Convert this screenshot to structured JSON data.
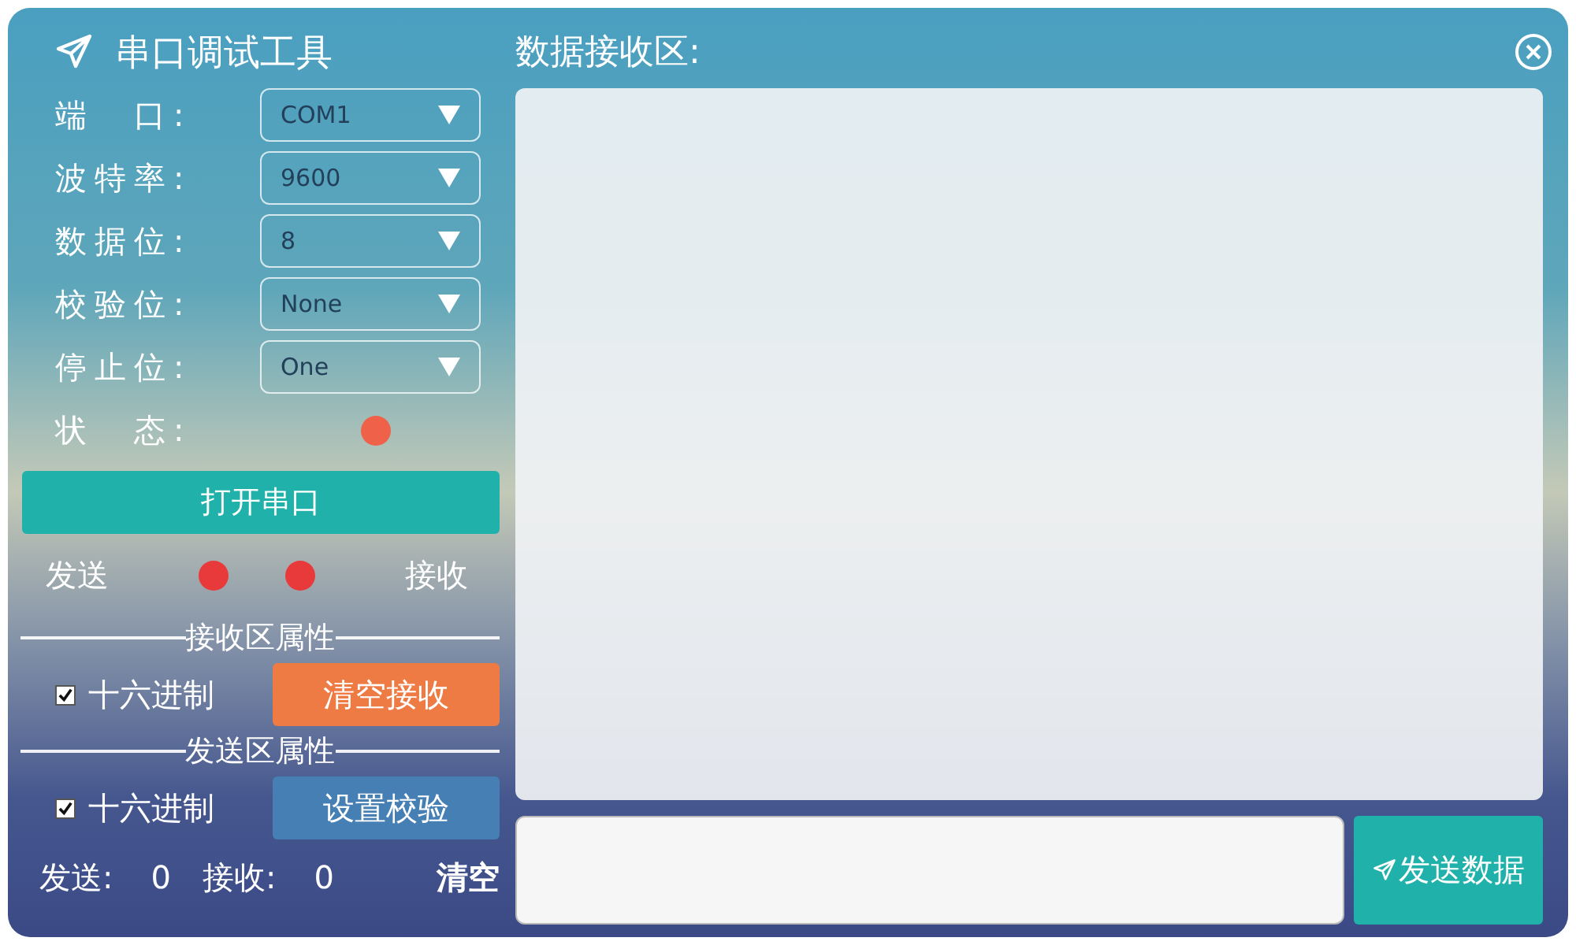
{
  "title": "串口调试工具",
  "settings": [
    {
      "label": "端　口:",
      "value": "COM1"
    },
    {
      "label": "波特率:",
      "value": "9600"
    },
    {
      "label": "数据位:",
      "value": "8"
    },
    {
      "label": "校验位:",
      "value": "None"
    },
    {
      "label": "停止位:",
      "value": "One"
    }
  ],
  "status": {
    "label": "状　态:",
    "color": "#f0614a"
  },
  "open_button": "打开串口",
  "indicators": [
    {
      "label": "发送",
      "color": "#e83a3a"
    },
    {
      "label": "接收",
      "color": "#e83a3a"
    }
  ],
  "receive_section": {
    "title": "接收区属性",
    "hex": {
      "label": "十六进制",
      "checked": true
    },
    "button": {
      "label": "清空接收",
      "color": "#ee7b43"
    }
  },
  "send_section": {
    "title": "发送区属性",
    "hex": {
      "label": "十六进制",
      "checked": true
    },
    "button": {
      "label": "设置校验",
      "color": "#457fb3"
    }
  },
  "counters": {
    "sent_label": "发送:",
    "sent": "0",
    "received_label": "接收:",
    "received": "0",
    "clear": "清空"
  },
  "receive_area": {
    "title": "数据接收区:"
  },
  "send_button": "发送数据"
}
